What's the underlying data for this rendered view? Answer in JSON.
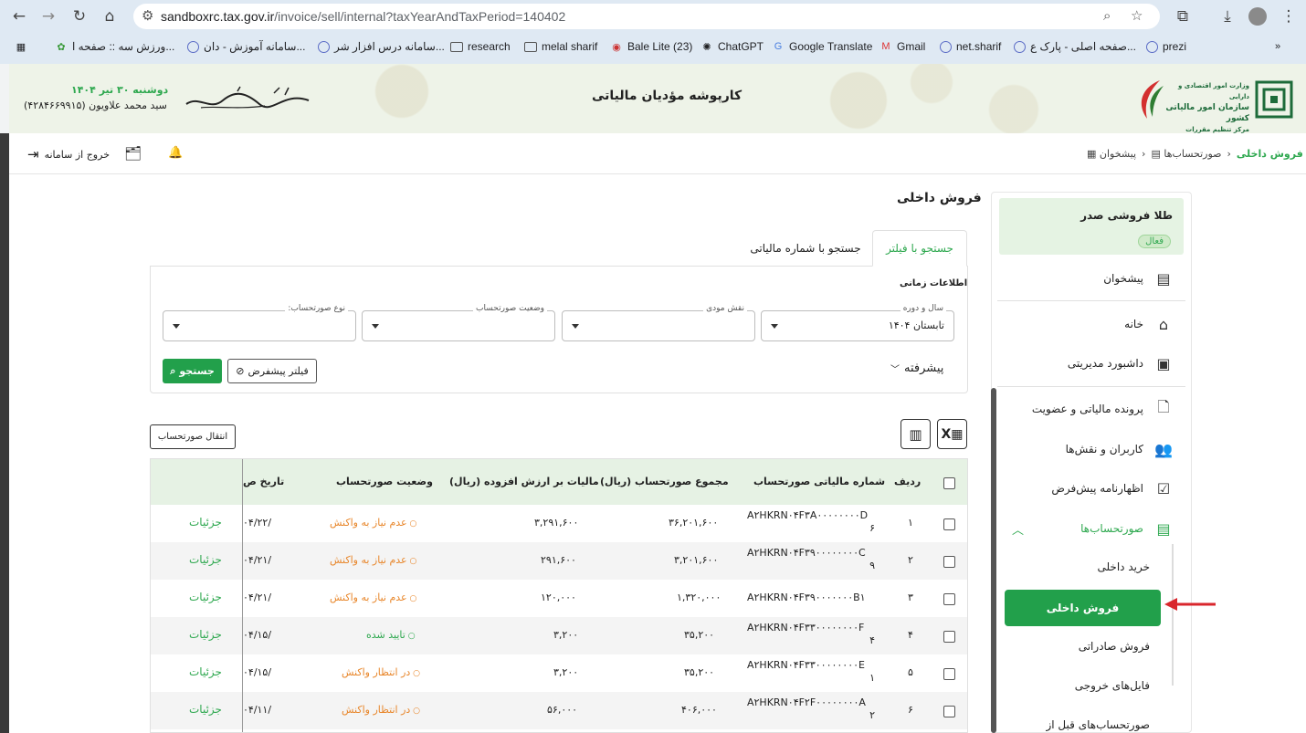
{
  "browser": {
    "url_domain": "sandboxrc.tax.gov.ir",
    "url_path": "/invoice/sell/internal?taxYearAndTaxPeriod=140402",
    "bookmarks": [
      {
        "label": "ورزش سه :: صفحه ا...",
        "icon": "green-logo-icon"
      },
      {
        "label": "سامانه آموزش - دان...",
        "icon": "globe-icon"
      },
      {
        "label": "سامانه درس افزار شر...",
        "icon": "globe-icon"
      },
      {
        "label": "research",
        "icon": "folder-icon"
      },
      {
        "label": "melal sharif",
        "icon": "folder-icon"
      },
      {
        "label": "Bale Lite (23)",
        "icon": "bale-icon"
      },
      {
        "label": "ChatGPT",
        "icon": "chatgpt-icon"
      },
      {
        "label": "Google Translate",
        "icon": "translate-icon"
      },
      {
        "label": "Gmail",
        "icon": "gmail-icon"
      },
      {
        "label": "net.sharif",
        "icon": "globe-icon"
      },
      {
        "label": "صفحه اصلی - پارک ع...",
        "icon": "globe-icon"
      },
      {
        "label": "prezi",
        "icon": "globe-icon"
      }
    ]
  },
  "header": {
    "title": "کارپوشه مؤدیان مالیاتی",
    "date": "دوشنبه ۳۰ تیر ۱۴۰۴",
    "user": "سید محمد علاویون (۴۲۸۴۶۶۹۹۱۵)",
    "logo_line1": "وزارت امور اقتصادی و دارایی",
    "logo_line2": "سازمان امور مالیاتی کشور",
    "logo_line3": "مرکز تنظیم مقررات"
  },
  "topbar": {
    "breadcrumb": [
      "پیشخوان",
      "صورتحساب‌ها",
      "فروش داخلی"
    ],
    "logout_label": "خروج از سامانه"
  },
  "sidebar": {
    "company_name": "طلا فروشی صدر",
    "company_status": "فعال",
    "items": [
      {
        "label": "پیشخوان",
        "icon": "dashboard-icon"
      },
      {
        "label": "خانه",
        "icon": "home-icon"
      },
      {
        "label": "داشبورد مدیریتی",
        "icon": "grid-icon"
      },
      {
        "label": "پرونده مالیاتی و عضویت",
        "icon": "file-icon"
      },
      {
        "label": "کاربران و نقش‌ها",
        "icon": "users-icon"
      },
      {
        "label": "اظهارنامه پیش‌فرض",
        "icon": "checklist-icon"
      },
      {
        "label": "صورتحساب‌ها",
        "icon": "receipt-icon"
      }
    ],
    "sub_items": [
      "خرید داخلی",
      "فروش داخلی",
      "فروش صادراتی",
      "فایل‌های خروجی",
      "صورتحساب‌های قبل از"
    ]
  },
  "main": {
    "title": "فروش داخلی",
    "tabs": [
      "جستجو با فیلتر",
      "جستجو با شماره مالیاتی"
    ],
    "time_info_label": "اطلاعات زمانی",
    "filters": [
      {
        "label": "سال و دوره",
        "value": "تابستان ۱۴۰۴"
      },
      {
        "label": "نقش مودی",
        "value": ""
      },
      {
        "label": "وضعیت صورتحساب",
        "value": ""
      },
      {
        "label": "نوع صورتحساب:",
        "value": ""
      }
    ],
    "advanced_label": "پیشرفته",
    "default_filter_label": "فیلتر پیشفرض",
    "search_label": "جستجو",
    "transfer_label": "انتقال صورتحساب"
  },
  "table": {
    "headers": [
      "ردیف",
      "شماره مالیاتی صورتحساب",
      "مجموع صورتحساب (ریال)",
      "مالیات بر ارزش افزوده (ریال)",
      "وضعیت صورتحساب",
      "تاریخ ص"
    ],
    "details_label": "جزئیات",
    "rows": [
      {
        "idx": "۱",
        "inv1": "A۲HKRN۰۴F۳A۰۰۰۰۰۰۰۰D",
        "inv2": "۶",
        "total": "۳۶,۲۰۱,۶۰۰",
        "vat": "۳,۲۹۱,۶۰۰",
        "status": "عدم نیاز به واکنش",
        "status_color": "orange",
        "date": "/۰۴/۲۲"
      },
      {
        "idx": "۲",
        "inv1": "A۲HKRN۰۴F۳۹۰۰۰۰۰۰۰۰C",
        "inv2": "۹",
        "total": "۳,۲۰۱,۶۰۰",
        "vat": "۲۹۱,۶۰۰",
        "status": "عدم نیاز به واکنش",
        "status_color": "orange",
        "date": "/۰۴/۲۱"
      },
      {
        "idx": "۳",
        "inv1": "A۲HKRN۰۴F۳۹۰۰۰۰۰۰۰B۱",
        "inv2": "",
        "total": "۱,۳۲۰,۰۰۰",
        "vat": "۱۲۰,۰۰۰",
        "status": "عدم نیاز به واکنش",
        "status_color": "orange",
        "date": "/۰۴/۲۱"
      },
      {
        "idx": "۴",
        "inv1": "A۲HKRN۰۴F۳۳۰۰۰۰۰۰۰۰F",
        "inv2": "۴",
        "total": "۳۵,۲۰۰",
        "vat": "۳,۲۰۰",
        "status": "تایید شده",
        "status_color": "green",
        "date": "/۰۴/۱۵"
      },
      {
        "idx": "۵",
        "inv1": "A۲HKRN۰۴F۳۳۰۰۰۰۰۰۰۰E",
        "inv2": "۱",
        "total": "۳۵,۲۰۰",
        "vat": "۳,۲۰۰",
        "status": "در انتظار واکنش",
        "status_color": "orange",
        "date": "/۰۴/۱۵"
      },
      {
        "idx": "۶",
        "inv1": "A۲HKRN۰۴F۲F۰۰۰۰۰۰۰۰A",
        "inv2": "۲",
        "total": "۴۰۶,۰۰۰",
        "vat": "۵۶,۰۰۰",
        "status": "در انتظار واکنش",
        "status_color": "orange",
        "date": "/۰۴/۱۱"
      }
    ]
  },
  "colors": {
    "accent": "#22a04b",
    "orange": "#e8862a",
    "arrow": "#d9262c"
  }
}
